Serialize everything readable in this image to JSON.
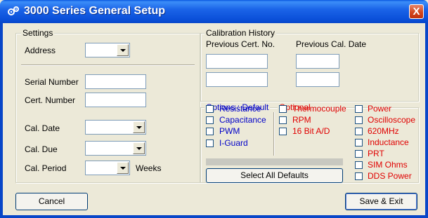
{
  "window": {
    "title": "3000 Series General Setup",
    "close_label": "X"
  },
  "settings": {
    "legend": "Settings",
    "address_label": "Address",
    "address_value": "",
    "serial_label": "Serial Number",
    "serial_value": "",
    "cert_label": "Cert. Number",
    "cert_value": "",
    "cal_date_label": "Cal. Date",
    "cal_date_value": "",
    "cal_due_label": "Cal. Due",
    "cal_due_value": "",
    "cal_period_label": "Cal. Period",
    "cal_period_value": "",
    "weeks_label": "Weeks"
  },
  "calibration_history": {
    "legend": "Calibration History",
    "prev_cert_label": "Previous Cert. No.",
    "prev_date_label": "Previous Cal. Date"
  },
  "options_default": {
    "legend": "Options : Default",
    "items": [
      "Resistance",
      "Capacitance",
      "PWM",
      "I-Guard"
    ]
  },
  "optional": {
    "legend": "Optional",
    "col1": [
      "Thermocouple",
      "RPM",
      "16 Bit A/D"
    ],
    "col2": [
      "Power",
      "Oscilloscope",
      "620MHz",
      "Inductance",
      "PRT",
      "SIM Ohms",
      "DDS Power"
    ]
  },
  "buttons": {
    "select_all": "Select All Defaults",
    "cancel": "Cancel",
    "save_exit": "Save & Exit"
  },
  "colors": {
    "title_bar": "#0a4fd8",
    "default_option_text": "#0000c8",
    "optional_text": "#e00000",
    "window_bg": "#ece9d8"
  }
}
